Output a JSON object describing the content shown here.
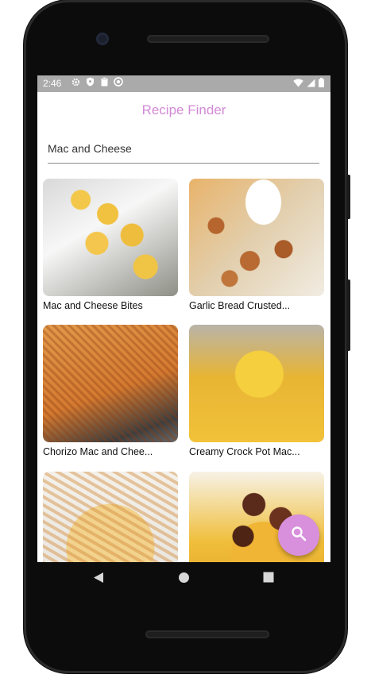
{
  "status": {
    "time": "2:46",
    "icons": [
      "gear-icon",
      "shield-icon",
      "clipboard-icon",
      "sync-icon"
    ],
    "right_icons": [
      "wifi-icon",
      "signal-icon",
      "battery-icon"
    ]
  },
  "app": {
    "title": "Recipe Finder"
  },
  "search": {
    "value": "Mac and Cheese",
    "placeholder": ""
  },
  "recipes": [
    {
      "title": "Mac and Cheese Bites"
    },
    {
      "title": "Garlic Bread Crusted..."
    },
    {
      "title": "Chorizo Mac and Chee..."
    },
    {
      "title": "Creamy Crock Pot Mac..."
    },
    {
      "title": ""
    },
    {
      "title": ""
    }
  ],
  "fab": {
    "icon": "search-icon"
  },
  "colors": {
    "accent": "#d38ad7",
    "fab": "#d88fdc",
    "statusbar": "#aaaaaa"
  }
}
